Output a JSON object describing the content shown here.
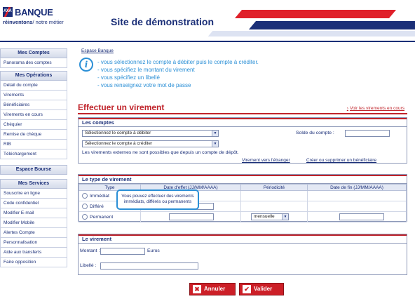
{
  "header": {
    "logo_text": "AXA",
    "brand": "BANQUE",
    "tagline_bold": "réinventons",
    "tagline_rest": "/ notre métier",
    "site_title": "Site de démonstration"
  },
  "sidebar": {
    "groups": [
      {
        "title": "Mes Comptes",
        "items": [
          "Panorama des comptes"
        ]
      },
      {
        "title": "Mes Opérations",
        "items": [
          "Détail du compte",
          "Virements",
          "Bénéficiaires",
          "Virements en cours",
          "Chéquier",
          "Remise de chèque",
          "RIB",
          "Téléchargement"
        ]
      },
      {
        "title": "Espace Bourse",
        "items": []
      },
      {
        "title": "Mes Services",
        "items": [
          "Souscrire en ligne",
          "Code confidentiel",
          "Modifier E-mail",
          "Modifier Mobile",
          "Alertes Compte",
          "Personnalisation",
          "Aide aux transferts",
          "Faire opposition"
        ]
      }
    ]
  },
  "breadcrumb": "Espace Banque",
  "info": {
    "lines": [
      "- vous sélectionnez le compte à débiter puis le compte à créditer.",
      "- vous spécifiez le montant du virement",
      "- vous spécifiez un libellé",
      "- vous renseignez votre mot de passe"
    ]
  },
  "page_title": "Effectuer un virement",
  "link_current": "Voir les virements en cours",
  "comptes": {
    "title": "Les comptes",
    "debit_select": "Sélectionnez le compte à débiter",
    "credit_select": "Sélectionnez le compte à créditer",
    "solde_label": "Solde du compte :",
    "note": "Les virements externes ne sont possibles que depuis un compte de dépôt.",
    "link_foreign": "Virement vers l'étranger",
    "link_beneficiary": "Créer ou supprimer un bénéficiaire"
  },
  "type": {
    "title": "Le type de virement",
    "headers": [
      "Type",
      "Date d'effet (JJ/MM/AAAA)",
      "Périodicité",
      "Date de fin (JJ/MM/AAAA)"
    ],
    "rows": [
      "Immédiat",
      "Différé",
      "Permanent"
    ],
    "periodicity": "mensuelle",
    "tooltip_line1": "Vous pouvez effectuer des virements",
    "tooltip_line2": "immédiats, différés ou permanents"
  },
  "virement": {
    "title": "Le virement",
    "montant_label": "Montant :",
    "currency": "Euros",
    "libelle_label": "Libellé :"
  },
  "buttons": {
    "cancel": "Annuler",
    "validate": "Valider"
  },
  "colors": {
    "brand_blue": "#1b2f78",
    "accent_red": "#c0242b",
    "info_blue": "#2a8fd6"
  }
}
